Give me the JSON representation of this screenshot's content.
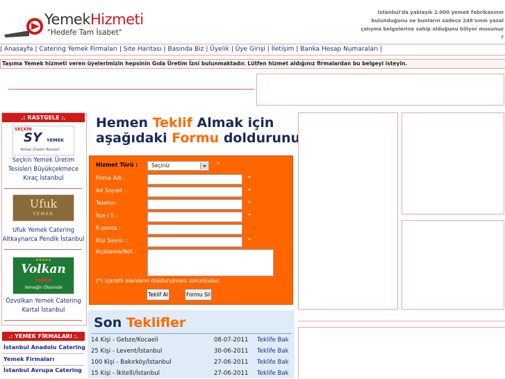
{
  "header": {
    "logo_brand_1": "Yemek",
    "logo_brand_2": "Hizmeti",
    "logo_tagline": "\"Hedefe Tam İsabet\"",
    "notice_lines": [
      "İstanbul'da yaklaşık 2.000 yemek fabrikasının",
      "bulunduğunu ve bunların sadece 246'sının yasal",
      "çalışma belgelerine sahip olduğunu biliyor musunuz",
      "?"
    ]
  },
  "nav": {
    "sep": "|",
    "items": [
      "Anasayfa",
      "Catering Yemek Firmaları",
      "Site Haritası",
      "Basında Biz",
      "Üyelik",
      "Üye Girişi",
      "İletişim",
      "Banka Hesap Numaraları"
    ]
  },
  "warning": "Taşıma Yemek hizmeti veren üyelerimizin hepsinin Gıda Üretim İzni bulunmaktadır. Lütfen hizmet aldığınız firmalardan bu belgeyi isteyin.",
  "sidebar": {
    "random_title": ".: RASTGELE :.",
    "firms": [
      {
        "logo_top": "SEÇKİN",
        "logo_mid": "SY",
        "logo_right": "YEMEK",
        "logo_sub": "Yemek Üretim Tesisleri",
        "caption": "Seçkin Yemek Üretim Tesisleri Büyükçekmece Kıraç İstanbul"
      },
      {
        "logo_top": "Ufuk",
        "logo_sub": "YEMEK",
        "caption": "Ufuk Yemek Catering Altkaynarca Pendik İstanbul"
      },
      {
        "logo_top": "Volkan",
        "logo_mid": "YEMEK",
        "logo_sub": "Yemeğin Ötesinde",
        "caption": "Özvolkan Yemek Catering Kartal İstanbul"
      }
    ],
    "firms_title": ".: YEMEK FİRMALARI :.",
    "firm_links": [
      "İstanbul Anadolu Catering",
      "Yemek Firmaları",
      "İstanbul Avrupa Catering"
    ]
  },
  "banner": {
    "line1_a": "Hemen ",
    "line1_b": "Teklif ",
    "line1_c": "Almak için",
    "line2_a": "aşağıdaki ",
    "line2_b": "Formu ",
    "line2_c": "doldurunuz."
  },
  "form": {
    "service_label": "Hizmet Türü :",
    "service_select": "Seçiniz",
    "fields": [
      "Firma Adı :",
      "Ad Soyad :",
      "Telefon :",
      "İlçe / İl :",
      "E-posta :",
      "Kişi Sayısı :",
      "Açıklama/Not :"
    ],
    "required_mark": "*",
    "note": "(*) işaretli alanların doldurulması zorunludur.",
    "submit_label": "Teklif Al",
    "reset_label": "Formu Sil"
  },
  "offers": {
    "title_a": "Son ",
    "title_b": "Teklifler",
    "rows": [
      {
        "desc": "14 Kişi - Gebze/Kocaeli",
        "date": "08-07-2011",
        "link": "Teklife Bak"
      },
      {
        "desc": "25 Kişi - Levent/İstanbul",
        "date": "30-06-2011",
        "link": "Teklife Bak"
      },
      {
        "desc": "100 Kişi - Bakırköy/İstanbul",
        "date": "27-06-2011",
        "link": "Teklife Bak"
      },
      {
        "desc": "15 Kişi - İkitelli/İstanbul",
        "date": "27-06-2011",
        "link": "Teklife Bak"
      }
    ]
  },
  "colors": {
    "accent_red": "#d01818",
    "form_orange": "#ff6600",
    "nav_blue": "#1a2a8c"
  }
}
